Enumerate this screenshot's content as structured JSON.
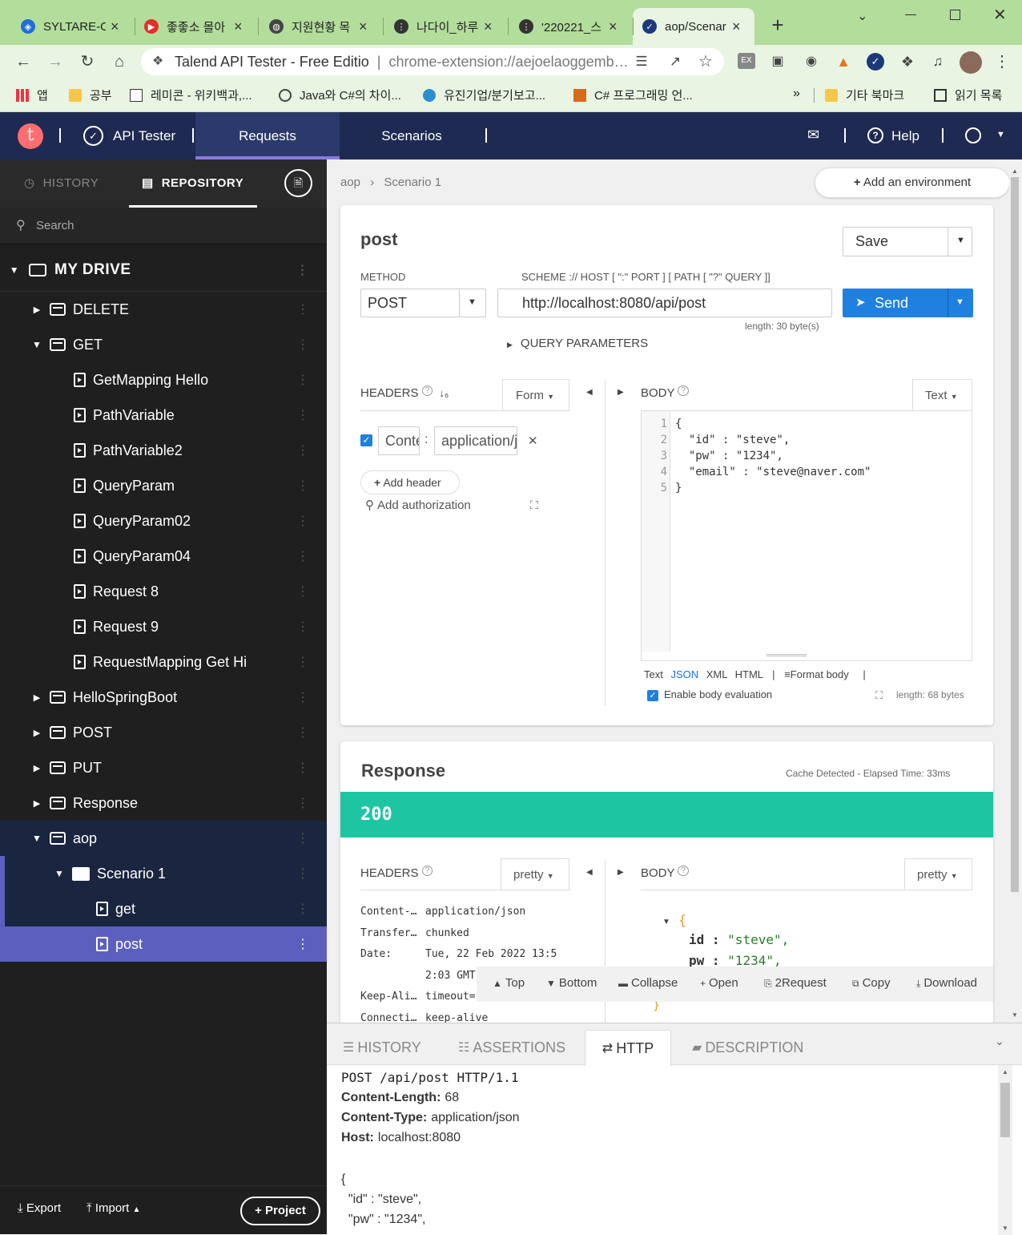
{
  "browser": {
    "tabs": [
      {
        "title": "SYLTARE-O",
        "fav_color": "#1e6fd9",
        "fav_glyph": "◈"
      },
      {
        "title": "좋좋소 몰아",
        "fav_color": "#e52d27",
        "fav_glyph": "▶"
      },
      {
        "title": "지원현황 목",
        "fav_color": "#444444",
        "fav_glyph": "◍"
      },
      {
        "title": "나다이_하루",
        "fav_color": "#333333",
        "fav_glyph": "⋮"
      },
      {
        "title": "'220221_스",
        "fav_color": "#333333",
        "fav_glyph": "⋮"
      },
      {
        "title": "aop/Scenar",
        "fav_color": "#1a3a7a",
        "fav_glyph": "✓"
      }
    ],
    "new_tab": "+",
    "omnibox": {
      "site": "Talend API Tester - Free Editio",
      "divider": "|",
      "url": "chrome-extension://aejoelaoggemb…"
    },
    "bookmarks": [
      {
        "label": "앱",
        "icon": "apps-icon"
      },
      {
        "label": "공부",
        "icon": "folder-icon"
      },
      {
        "label": "레미콘 - 위키백과,...",
        "icon": "wikipedia-icon"
      },
      {
        "label": "Java와 C#의 차이...",
        "icon": "link-icon"
      },
      {
        "label": "유진기업/분기보고...",
        "icon": "globe-icon"
      },
      {
        "label": "C# 프로그래밍 언...",
        "icon": "site-icon"
      }
    ],
    "bookmarks_more": "»",
    "bookmarks_right": [
      {
        "label": "기타 북마크",
        "icon": "folder-icon"
      },
      {
        "label": "읽기 목록",
        "icon": "reading-list-icon"
      }
    ]
  },
  "app": {
    "logo_letter": "t",
    "product": "API Tester",
    "nav": [
      "Requests",
      "Scenarios"
    ],
    "help": "Help"
  },
  "sidebar": {
    "tabs": [
      "HISTORY",
      "REPOSITORY"
    ],
    "search_placeholder": "Search",
    "drive": "MY DRIVE",
    "tree": [
      {
        "label": "DELETE",
        "type": "folder",
        "level": 1,
        "expanded": false
      },
      {
        "label": "GET",
        "type": "folder",
        "level": 1,
        "expanded": true
      },
      {
        "label": "GetMapping Hello",
        "type": "request",
        "level": 2
      },
      {
        "label": "PathVariable",
        "type": "request",
        "level": 2
      },
      {
        "label": "PathVariable2",
        "type": "request",
        "level": 2
      },
      {
        "label": "QueryParam",
        "type": "request",
        "level": 2
      },
      {
        "label": "QueryParam02",
        "type": "request",
        "level": 2
      },
      {
        "label": "QueryParam04",
        "type": "request",
        "level": 2
      },
      {
        "label": "Request 8",
        "type": "request",
        "level": 2
      },
      {
        "label": "Request 9",
        "type": "request",
        "level": 2
      },
      {
        "label": "RequestMapping Get Hi",
        "type": "request",
        "level": 2
      },
      {
        "label": "HelloSpringBoot",
        "type": "folder",
        "level": 1,
        "expanded": false
      },
      {
        "label": "POST",
        "type": "folder",
        "level": 1,
        "expanded": false
      },
      {
        "label": "PUT",
        "type": "folder",
        "level": 1,
        "expanded": false
      },
      {
        "label": "Response",
        "type": "folder",
        "level": 1,
        "expanded": false
      },
      {
        "label": "aop",
        "type": "folder",
        "level": 1,
        "expanded": true
      },
      {
        "label": "Scenario 1",
        "type": "scenario",
        "level": 2,
        "expanded": true
      },
      {
        "label": "get",
        "type": "request",
        "level": 3
      },
      {
        "label": "post",
        "type": "request",
        "level": 3,
        "selected": true
      }
    ],
    "export": "Export",
    "import": "Import",
    "project": "Project"
  },
  "breadcrumb": [
    "aop",
    "Scenario 1"
  ],
  "add_environment": "Add an environment",
  "request": {
    "name": "post",
    "save": "Save",
    "method_label": "METHOD",
    "method": "POST",
    "scheme_label": "SCHEME :// HOST [ \":\" PORT ] [ PATH [ \"?\" QUERY ]]",
    "url": "http://localhost:8080/api/post",
    "length": "length: 30 byte(s)",
    "send": "Send",
    "query_params": "QUERY PARAMETERS",
    "headers_label": "HEADERS",
    "headers_mode": "Form",
    "header_name": "Conte",
    "header_value": "application/json",
    "add_header": "Add header",
    "add_authorization": "Add authorization",
    "body_label": "BODY",
    "body_mode": "Text",
    "body_lines": [
      {
        "n": "1",
        "text": "{"
      },
      {
        "n": "2",
        "text": "  \"id\" : \"steve\","
      },
      {
        "n": "3",
        "text": "  \"pw\" : \"1234\","
      },
      {
        "n": "4",
        "text": "  \"email\" : \"steve@naver.com\""
      },
      {
        "n": "5",
        "text": "}"
      }
    ],
    "formats": [
      "Text",
      "JSON",
      "XML",
      "HTML"
    ],
    "format_body": "Format body",
    "enable_eval": "Enable body evaluation",
    "body_length": "length: 68 bytes"
  },
  "response": {
    "title": "Response",
    "meta": "Cache Detected - Elapsed Time: 33ms",
    "status": "200",
    "status_color": "#1ec5a3",
    "headers_label": "HEADERS",
    "headers_mode": "pretty",
    "body_label": "BODY",
    "body_mode": "pretty",
    "headers": [
      {
        "k": "Content-…",
        "v": "application/json"
      },
      {
        "k": "Transfer…",
        "v": "chunked"
      },
      {
        "k": "Date:",
        "v": "Tue, 22 Feb 2022 13:5"
      },
      {
        "k": "",
        "v": "2:03 GMT"
      },
      {
        "k": "Keep-Ali…",
        "v": "timeout="
      },
      {
        "k": "Connecti…",
        "v": "keep-alive"
      }
    ],
    "body": {
      "open": "{",
      "k1": "id :",
      "v1": "\"steve\",",
      "k2": "pw :",
      "v2": "\"1234\",",
      "close": "}"
    },
    "toolbar": [
      "Top",
      "Bottom",
      "Collapse",
      "Open",
      "2Request",
      "Copy",
      "Download"
    ]
  },
  "bottom": {
    "tabs": [
      "HISTORY",
      "ASSERTIONS",
      "HTTP",
      "DESCRIPTION"
    ],
    "active_tab": "HTTP",
    "request_line": "POST /api/post HTTP/1.1",
    "headers": [
      {
        "k": "Content-Length:",
        "v": "68"
      },
      {
        "k": "Content-Type:",
        "v": "application/json"
      },
      {
        "k": "Host:",
        "v": "localhost:8080"
      }
    ],
    "body_lines": [
      "{",
      "  \"id\" : \"steve\",",
      "  \"pw\" : \"1234\","
    ]
  }
}
